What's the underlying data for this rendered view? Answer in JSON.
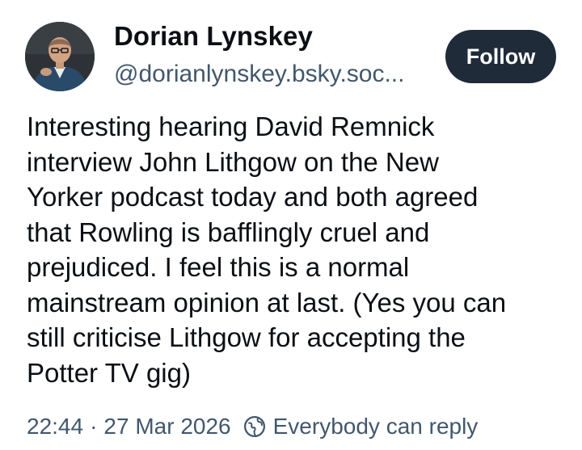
{
  "post": {
    "author": {
      "display_name": "Dorian Lynskey",
      "handle": "@dorianlynskey.bsky.soc..."
    },
    "follow_label": "Follow",
    "text": "Interesting hearing David Remnick\ninterview John Lithgow on the New\nYorker podcast today and both agreed\nthat Rowling is bafflingly cruel and\nprejudiced. I feel this is a normal\nmainstream opinion at last. (Yes you can\nstill criticise Lithgow for accepting the\nPotter TV gig)",
    "time": "22:44",
    "separator": "·",
    "date": "27 Mar 2026",
    "reply_setting": "Everybody can reply",
    "reply_icon": "globe-icon"
  },
  "colors": {
    "text": "#0b0f14",
    "secondary_text": "#42576c",
    "follow_button_bg": "#1f2b38",
    "follow_button_text": "#ffffff",
    "background": "#ffffff"
  }
}
